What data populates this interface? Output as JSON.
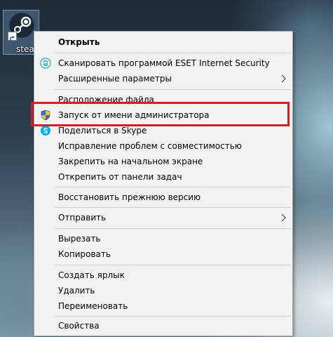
{
  "desktop": {
    "icon_label": "steam",
    "icon_name": "steam-icon"
  },
  "menu": {
    "items": [
      {
        "label": "Открыть",
        "bold": true
      },
      {
        "label": "Сканировать программой ESET Internet Security",
        "icon": "eset-icon"
      },
      {
        "label": "Расширенные параметры",
        "submenu": true
      },
      {
        "label": "Расположение файла"
      },
      {
        "label": "Запуск от имени администратора",
        "icon": "uac-shield-icon"
      },
      {
        "label": "Поделиться в Skype",
        "icon": "skype-icon"
      },
      {
        "label": "Исправление проблем с совместимостью"
      },
      {
        "label": "Закрепить на начальном экране"
      },
      {
        "label": "Открепить от панели задач"
      },
      {
        "label": "Восстановить прежнюю версию"
      },
      {
        "label": "Отправить",
        "submenu": true
      },
      {
        "label": "Вырезать"
      },
      {
        "label": "Копировать"
      },
      {
        "label": "Создать ярлык"
      },
      {
        "label": "Удалить"
      },
      {
        "label": "Переименовать"
      },
      {
        "label": "Свойства"
      }
    ]
  },
  "colors": {
    "highlight_border": "#d21f26",
    "menu_background": "#f2f2f2",
    "eset_accent": "#1aa1b4",
    "skype_blue": "#00aff0"
  }
}
